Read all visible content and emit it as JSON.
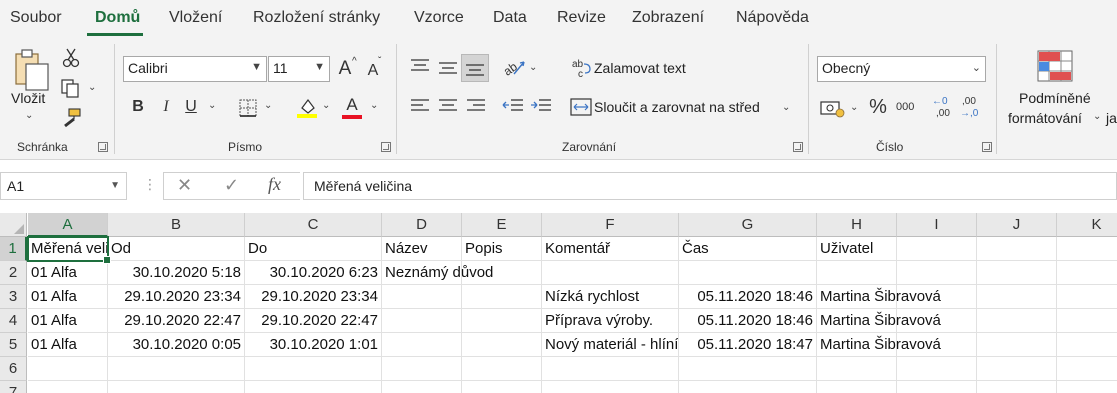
{
  "menu": {
    "tabs": [
      "Soubor",
      "Domů",
      "Vložení",
      "Rozložení stránky",
      "Vzorce",
      "Data",
      "Revize",
      "Zobrazení",
      "Nápověda"
    ],
    "active": "Domů"
  },
  "ribbon": {
    "clipboard": {
      "paste_label": "Vložit",
      "group_label": "Schránka"
    },
    "font": {
      "name": "Calibri",
      "size": "11",
      "group_label": "Písmo",
      "bold": "B",
      "italic": "I",
      "underline": "U",
      "grow": "A",
      "shrink": "A",
      "color_letter": "A",
      "highlight_color": "#ffff00",
      "font_color": "#e81123"
    },
    "alignment": {
      "wrap_text": "Zalamovat text",
      "merge_center": "Sloučit a zarovnat na střed",
      "group_label": "Zarovnání"
    },
    "number": {
      "format": "Obecný",
      "group_label": "Číslo",
      "percent": "%",
      "thousands": "000",
      "inc_decimal_top": "←0",
      "inc_decimal_bottom": ",00",
      "dec_decimal_top": ",00",
      "dec_decimal_bottom": "→,0"
    },
    "styles": {
      "conditional_line1": "Podmíněné",
      "conditional_line2": "formátování",
      "cut_text": "ja"
    }
  },
  "formula_bar": {
    "name_box": "A1",
    "cancel": "✕",
    "enter": "✓",
    "fx": "fx",
    "value": "Měřená veličina"
  },
  "sheet": {
    "columns": [
      "A",
      "B",
      "C",
      "D",
      "E",
      "F",
      "G",
      "H",
      "I",
      "J",
      "K"
    ],
    "rows": [
      "1",
      "2",
      "3",
      "4",
      "5",
      "6",
      "7"
    ],
    "cells": {
      "A1": "Měřená veličina",
      "B1": "Od",
      "C1": "Do",
      "D1": "Název",
      "E1": "Popis",
      "F1": "Komentář",
      "G1": "Čas",
      "H1": "Uživatel",
      "A2": "01 Alfa",
      "B2": "30.10.2020 5:18",
      "C2": "30.10.2020 6:23",
      "D2": "Neznámý důvod",
      "A3": "01 Alfa",
      "B3": "29.10.2020 23:34",
      "C3": "29.10.2020 23:34",
      "F3": "Nízká rychlost",
      "G3": "05.11.2020 18:46",
      "H3": "Martina Šibravová",
      "A4": "01 Alfa",
      "B4": "29.10.2020 22:47",
      "C4": "29.10.2020 22:47",
      "F4": "Příprava výroby.",
      "G4": "05.11.2020 18:46",
      "H4": "Martina Šibravová",
      "A5": "01 Alfa",
      "B5": "30.10.2020 0:05",
      "C5": "30.10.2020 1:01",
      "F5": "Nový materiál - hlíník",
      "G5": "05.11.2020 18:47",
      "H5": "Martina Šibravová"
    }
  }
}
